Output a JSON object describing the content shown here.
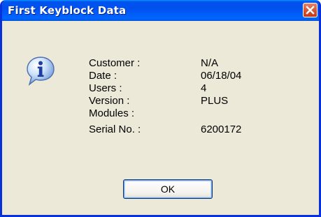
{
  "dialog": {
    "title": "First Keyblock Data",
    "icon": "info-icon",
    "ok_label": "OK"
  },
  "fields": [
    {
      "label": "Customer :",
      "value": "N/A"
    },
    {
      "label": "Date :",
      "value": "06/18/04"
    },
    {
      "label": "Users :",
      "value": "4"
    },
    {
      "label": "Version :",
      "value": "PLUS"
    },
    {
      "label": "Modules :",
      "value": ""
    },
    {
      "label": "Serial No. :",
      "value": "6200172"
    }
  ],
  "colors": {
    "titlebar": "#0053ee",
    "window_border": "#0831d9",
    "dialog_face": "#ece9d8",
    "close_button": "#d85b3c"
  }
}
